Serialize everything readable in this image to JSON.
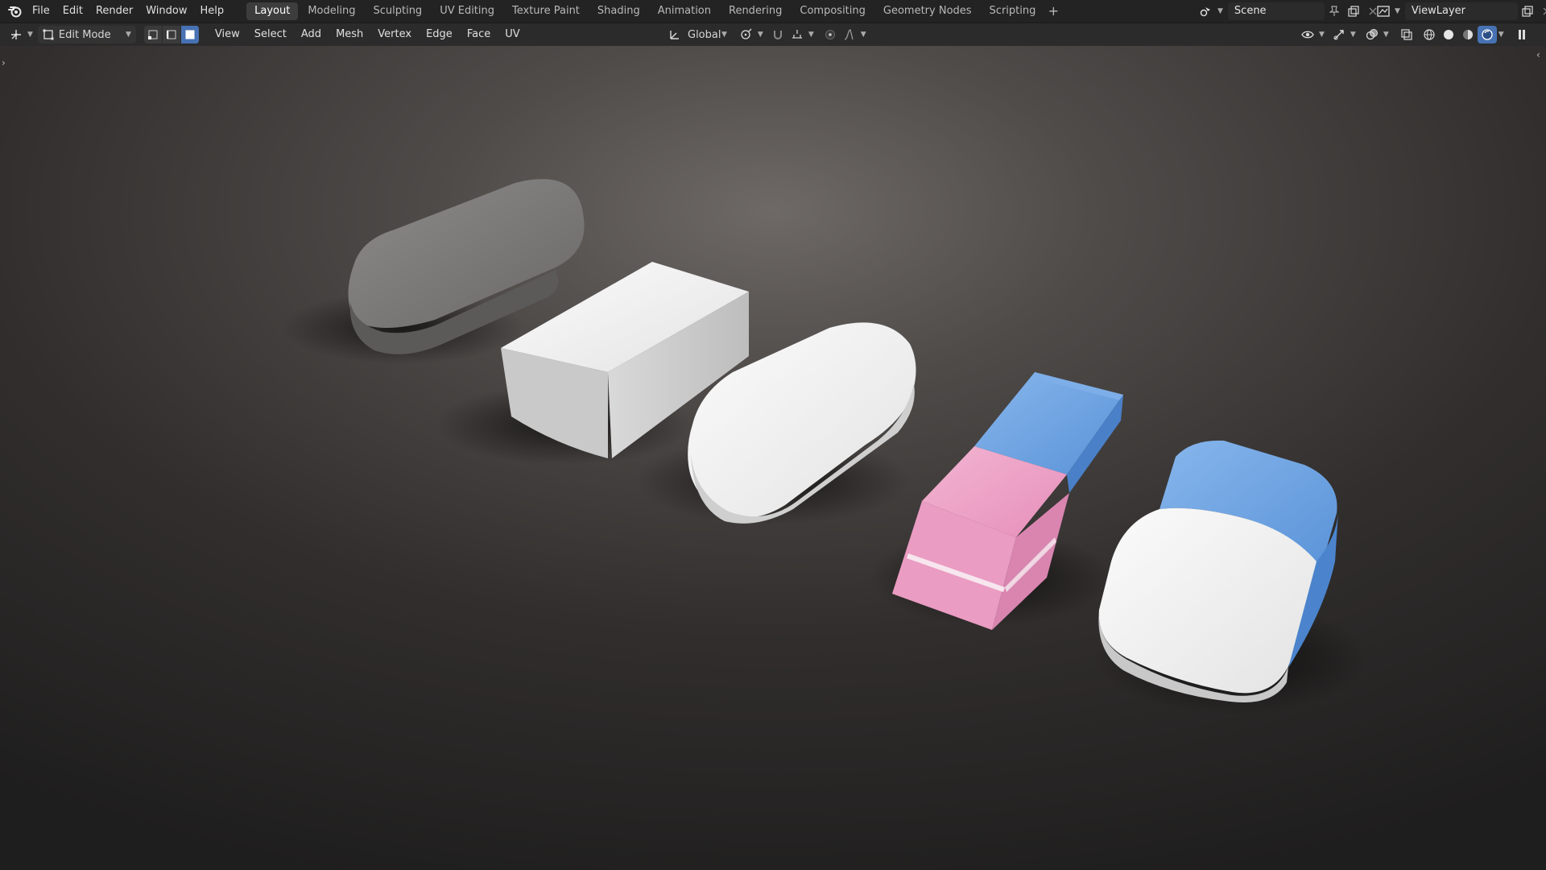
{
  "app": {
    "menu": [
      "File",
      "Edit",
      "Render",
      "Window",
      "Help"
    ],
    "workspaces": [
      "Layout",
      "Modeling",
      "Sculpting",
      "UV Editing",
      "Texture Paint",
      "Shading",
      "Animation",
      "Rendering",
      "Compositing",
      "Geometry Nodes",
      "Scripting"
    ],
    "active_workspace": "Layout",
    "add_tab": "+",
    "scene_name": "Scene",
    "view_layer_name": "ViewLayer"
  },
  "toolbar": {
    "mode": "Edit Mode",
    "menus": [
      "View",
      "Select",
      "Add",
      "Mesh",
      "Vertex",
      "Edge",
      "Face",
      "UV"
    ],
    "orientation": "Global",
    "select_modes": [
      "vertex",
      "edge",
      "face"
    ],
    "active_select_mode": "face"
  },
  "icons": {
    "logo": "blender-logo-icon",
    "editor_type": "3d-viewport-icon",
    "scene": "scene-icon",
    "pin": "pin-icon",
    "new": "duplicate-icon",
    "close": "close-icon",
    "view_layer": "view-layer-icon",
    "shading": [
      "wireframe-icon",
      "solid-icon",
      "material-preview-icon",
      "rendered-icon"
    ]
  },
  "colors": {
    "accent": "#4772b3",
    "topbar": "#232323",
    "toolbar": "#2b2b2b",
    "eraser_pink": "#e99ac0",
    "eraser_blue": "#5f97da"
  },
  "viewport": {
    "objects": [
      "gray-eraser",
      "white-block-eraser",
      "white-rounded-eraser",
      "pink-blue-eraser",
      "white-blue-eraser"
    ]
  }
}
